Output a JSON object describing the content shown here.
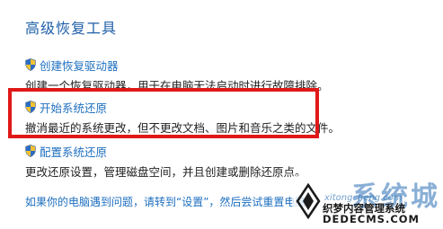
{
  "section_title": "高级恢复工具",
  "tools": [
    {
      "link": "创建恢复驱动器",
      "desc": "创建一个恢复驱动器，用于在电脑无法启动时进行故障排除。",
      "icon": "uac-shield-icon"
    },
    {
      "link": "开始系统还原",
      "desc": "撤消最近的系统更改，但不更改文档、图片和音乐之类的文件。",
      "icon": "uac-shield-icon"
    },
    {
      "link": "配置系统还原",
      "desc": "更改还原设置，管理磁盘空间，并且创建或删除还原点。",
      "icon": "uac-shield-icon"
    }
  ],
  "bottom_link": "如果你的电脑遇到问题，请转到“设置”，然后尝试重置电脑",
  "watermark": {
    "big": "系统城",
    "small": "xitongcheng.com",
    "line1": "织梦内容管理系统",
    "line2": "DEDECMS.COM"
  },
  "colors": {
    "title": "#1e5fa8",
    "link": "#1e6fbf",
    "highlight": "#e01818",
    "text": "#222222"
  }
}
